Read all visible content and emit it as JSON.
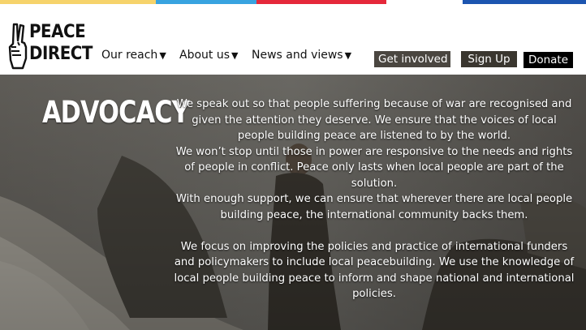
{
  "brand": {
    "logo_line1": "PEACE",
    "logo_line2": "DIRECT"
  },
  "nav": [
    {
      "label": "Our reach",
      "arrow": "▼"
    },
    {
      "label": "About us",
      "arrow": "▼"
    },
    {
      "label": "News and views",
      "arrow": "▼"
    }
  ],
  "actions": {
    "get_involved": "Get involved",
    "sign_up": "Sign Up",
    "donate": "Donate"
  },
  "colors": {
    "stripe_yellow": "#f6d36b",
    "stripe_blue": "#38a3e0",
    "stripe_red": "#e5283a",
    "stripe_navy": "#1c55b0"
  },
  "hero": {
    "heading": "ADVOCACY",
    "paragraph1": "We speak out so that people suffering because of war are recognised and given the attention they deserve. We ensure that the voices of local people building peace are listened to by the world.",
    "paragraph2": "We won’t stop until those in power are responsive to the needs and rights of people in conflict. Peace only lasts when local people are part of the solution.",
    "paragraph3": "With enough support, we can ensure that wherever there are local people building peace, the international community backs them.",
    "paragraph4": "We focus on improving the policies and practice of international funders and policymakers to include local peacebuilding. We use the knowledge of local people building peace to inform and shape national and international policies."
  }
}
